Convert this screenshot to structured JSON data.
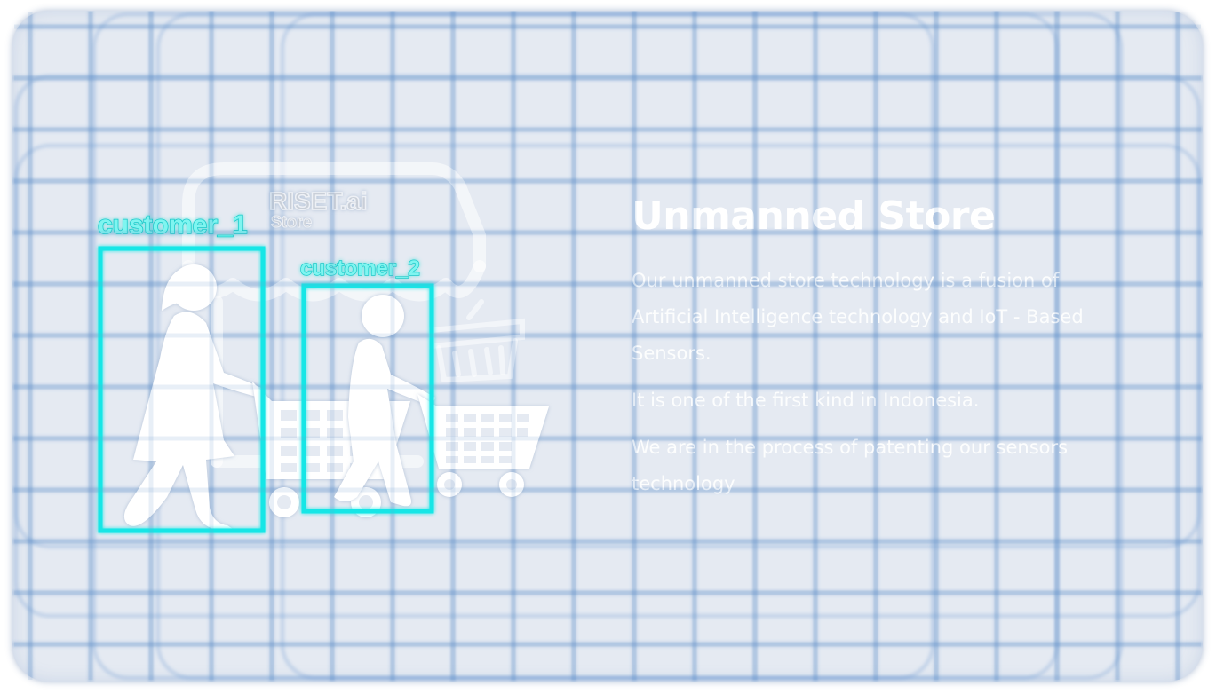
{
  "hero": {
    "title": "Unmanned Store",
    "paragraphs": [
      "Our unmanned store technology is a fusion of Artificial Intelligence technology and IoT - Based Sensors.",
      "It is one of the first kind in Indonesia.",
      "We are in the process of patenting our sensors technology"
    ]
  },
  "illustration": {
    "store_brand": "RISET.ai",
    "store_sub": "Store",
    "detection_labels": [
      "customer_1",
      "customer_2"
    ],
    "detection_color": "#19e6e6"
  },
  "colors": {
    "panel_bg": "#e5eaf2",
    "grid_line": "#4f86c6",
    "text": "#ffffff"
  }
}
